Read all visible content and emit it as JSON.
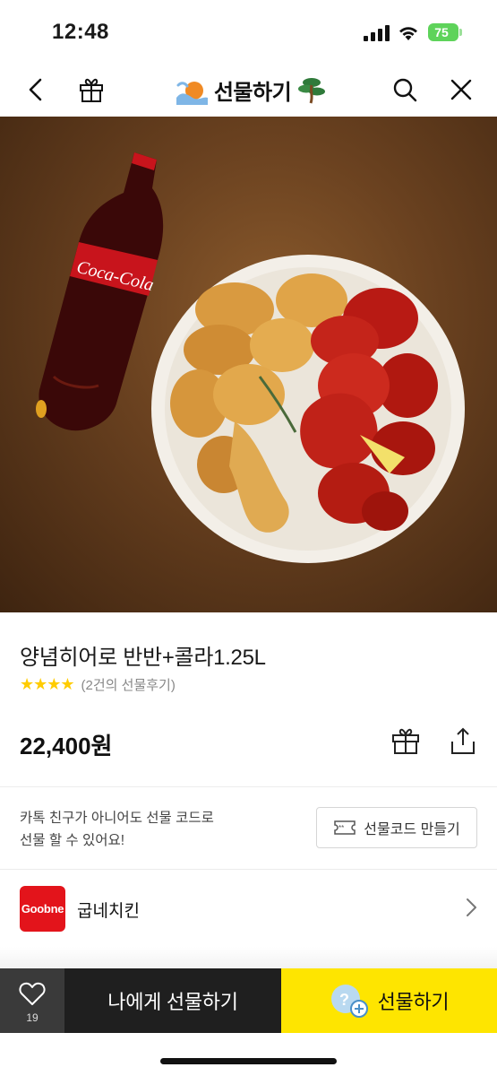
{
  "status_bar": {
    "time": "12:48",
    "battery": "75"
  },
  "nav": {
    "title": "선물하기",
    "icons": [
      "back-icon",
      "gift-icon",
      "search-icon",
      "close-icon"
    ]
  },
  "product": {
    "name": "양념히어로 반반+콜라1.25L",
    "stars": "★★★★",
    "review_text": "(2건의 선물후기)",
    "price": "22,400원"
  },
  "gift_code": {
    "info_line1": "카톡 친구가 아니어도 선물 코드로",
    "info_line2": "선물 할 수 있어요!",
    "button_label": "선물코드 만들기"
  },
  "brand": {
    "logo_text": "Goobne",
    "name": "굽네치킨"
  },
  "bottom_bar": {
    "like_count": "19",
    "self_gift_label": "나에게 선물하기",
    "gift_label": "선물하기"
  },
  "colors": {
    "kakao_yellow": "#fee500",
    "star": "#ffcc00",
    "brand_red": "#e3141b",
    "dark_button": "#1f1f1f"
  }
}
